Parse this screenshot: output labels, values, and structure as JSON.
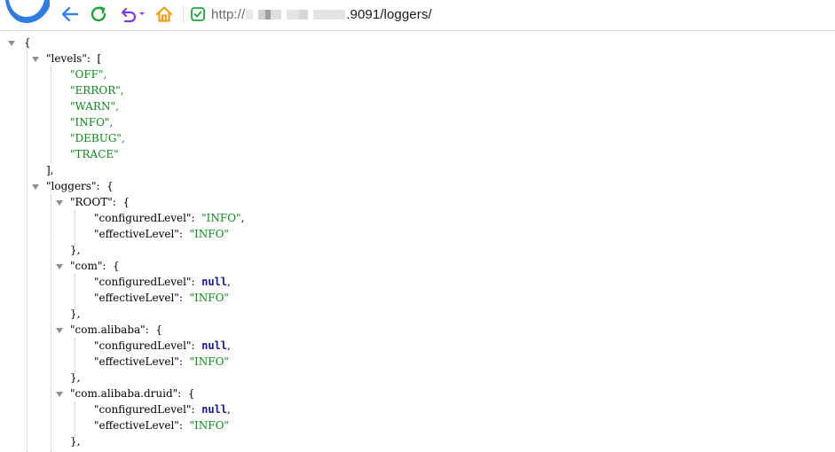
{
  "browser": {
    "url_prefix": "http://",
    "url_suffix": ".9091/loggers/"
  },
  "json": {
    "open_root": "{",
    "levels_key": "\"levels\"",
    "levels_colon": ":  [",
    "levels": [
      "\"OFF\",",
      "\"ERROR\",",
      "\"WARN\",",
      "\"INFO\",",
      "\"DEBUG\",",
      "\"TRACE\""
    ],
    "levels_close": "],",
    "loggers_key": "\"loggers\"",
    "loggers_colon": ":  {",
    "entries": [
      {
        "name": "\"ROOT\"",
        "colon": ":  {",
        "configured_key": "\"configuredLevel\"",
        "configured_colon": ":  ",
        "configured_value": "\"INFO\"",
        "configured_comma": ",",
        "effective_key": "\"effectiveLevel\"",
        "effective_colon": ":  ",
        "effective_value": "\"INFO\"",
        "close": "},"
      },
      {
        "name": "\"com\"",
        "colon": ":  {",
        "configured_key": "\"configuredLevel\"",
        "configured_colon": ":  ",
        "configured_value": "null",
        "configured_comma": ",",
        "effective_key": "\"effectiveLevel\"",
        "effective_colon": ":  ",
        "effective_value": "\"INFO\"",
        "close": "},"
      },
      {
        "name": "\"com.alibaba\"",
        "colon": ":  {",
        "configured_key": "\"configuredLevel\"",
        "configured_colon": ":  ",
        "configured_value": "null",
        "configured_comma": ",",
        "effective_key": "\"effectiveLevel\"",
        "effective_colon": ":  ",
        "effective_value": "\"INFO\"",
        "close": "},"
      },
      {
        "name": "\"com.alibaba.druid\"",
        "colon": ":  {",
        "configured_key": "\"configuredLevel\"",
        "configured_colon": ":  ",
        "configured_value": "null",
        "configured_comma": ",",
        "effective_key": "\"effectiveLevel\"",
        "effective_colon": ":  ",
        "effective_value": "\"INFO\"",
        "close": "},"
      }
    ]
  },
  "colors": {
    "string": "#0b8a1a",
    "null": "#1a1a9c",
    "back_arrow": "#3b82f6",
    "refresh": "#22a33a",
    "undo": "#7c3aed",
    "home": "#f59e0b",
    "shield": "#22a33a"
  }
}
